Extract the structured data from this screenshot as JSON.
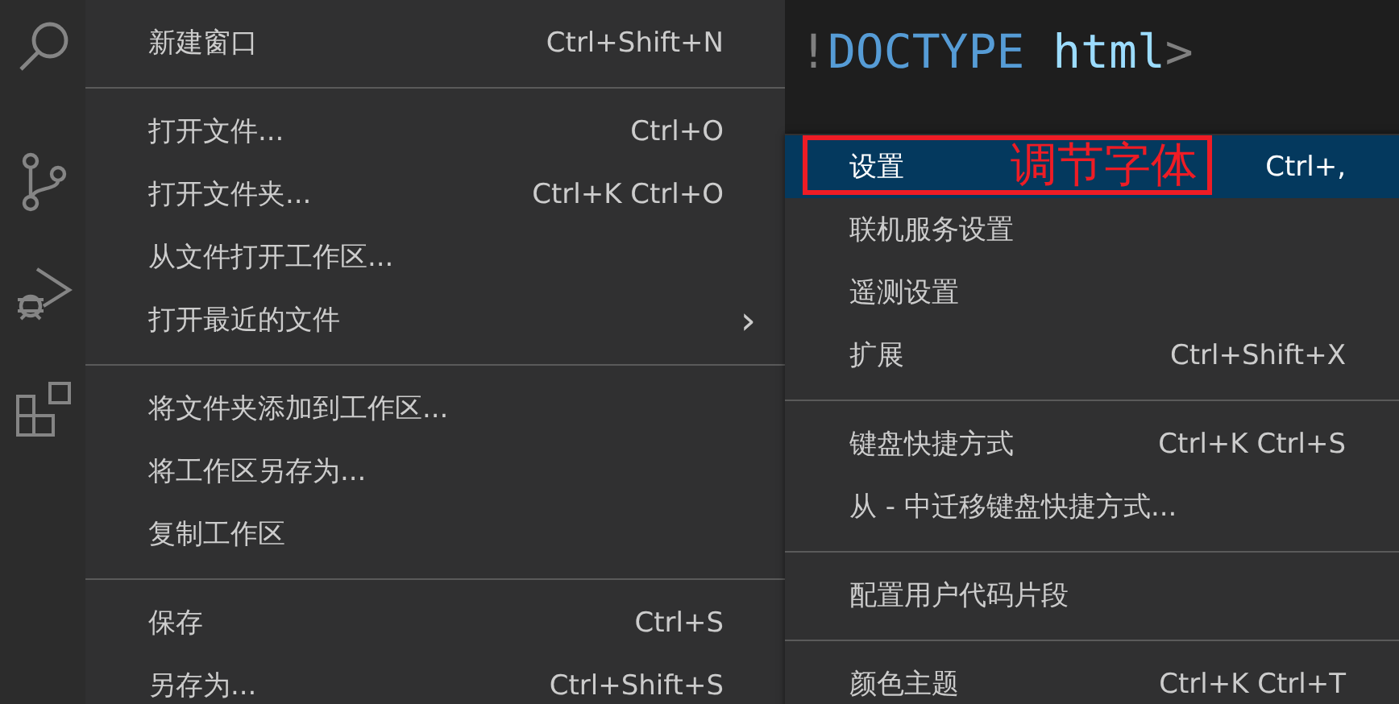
{
  "editor": {
    "code_tokens": [
      {
        "text": "!",
        "kind": "punct"
      },
      {
        "text": "DOCTYPE",
        "kind": "keyword"
      },
      {
        "text": "html",
        "kind": "attr"
      },
      {
        "text": ">",
        "kind": "punct"
      }
    ]
  },
  "menu": {
    "items": [
      {
        "kind": "item",
        "label": "新建窗口",
        "shortcut": "Ctrl+Shift+N"
      },
      {
        "kind": "separator"
      },
      {
        "kind": "item",
        "label": "打开文件...",
        "shortcut": "Ctrl+O"
      },
      {
        "kind": "item",
        "label": "打开文件夹...",
        "shortcut": "Ctrl+K Ctrl+O"
      },
      {
        "kind": "item",
        "label": "从文件打开工作区..."
      },
      {
        "kind": "item",
        "label": "打开最近的文件",
        "submenu_arrow": "›"
      },
      {
        "kind": "separator"
      },
      {
        "kind": "item",
        "label": "将文件夹添加到工作区..."
      },
      {
        "kind": "item",
        "label": "将工作区另存为..."
      },
      {
        "kind": "item",
        "label": "复制工作区"
      },
      {
        "kind": "separator"
      },
      {
        "kind": "item",
        "label": "保存",
        "shortcut": "Ctrl+S"
      },
      {
        "kind": "item",
        "label": "另存为...",
        "shortcut": "Ctrl+Shift+S"
      }
    ]
  },
  "submenu": {
    "items": [
      {
        "kind": "item",
        "label": "设置",
        "shortcut": "Ctrl+,",
        "selected": true
      },
      {
        "kind": "item",
        "label": "联机服务设置",
        "selected": false
      },
      {
        "kind": "item",
        "label": "遥测设置",
        "selected": false
      },
      {
        "kind": "item",
        "label": "扩展",
        "shortcut": "Ctrl+Shift+X",
        "selected": false
      },
      {
        "kind": "separator"
      },
      {
        "kind": "item",
        "label": "键盘快捷方式",
        "shortcut": "Ctrl+K Ctrl+S",
        "selected": false
      },
      {
        "kind": "item",
        "label": "从 - 中迁移键盘快捷方式...",
        "selected": false
      },
      {
        "kind": "separator"
      },
      {
        "kind": "item",
        "label": "配置用户代码片段",
        "selected": false
      },
      {
        "kind": "separator"
      },
      {
        "kind": "item",
        "label": "颜色主题",
        "shortcut": "Ctrl+K Ctrl+T",
        "selected": false
      }
    ]
  },
  "annotation": {
    "text": "调节字体"
  }
}
